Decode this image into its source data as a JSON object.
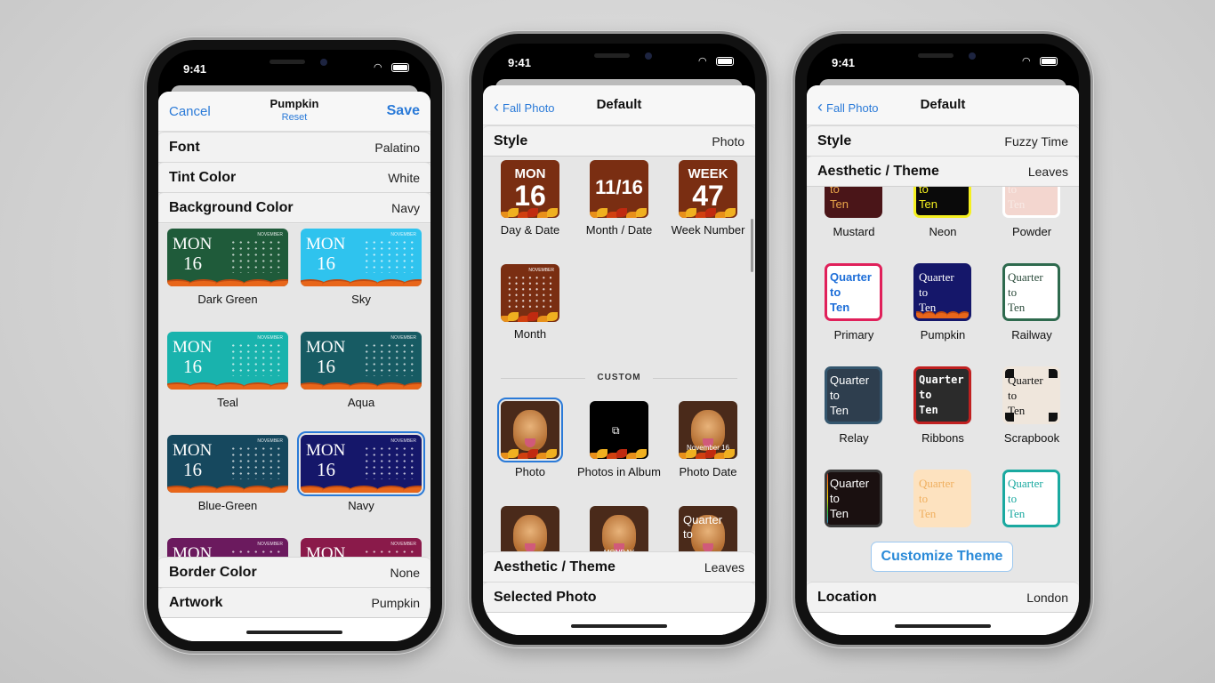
{
  "status_time": "9:41",
  "phones": [
    {
      "nav": {
        "left": "Cancel",
        "title": "Pumpkin",
        "subtitle": "Reset",
        "right": "Save"
      },
      "rows_top": [
        {
          "label": "Font",
          "value": "Palatino"
        },
        {
          "label": "Tint Color",
          "value": "White"
        },
        {
          "label": "Background Color",
          "value": "Navy"
        }
      ],
      "tile_text": {
        "day": "MON",
        "date": "16",
        "month": "NOVEMBER"
      },
      "tiles": [
        {
          "label": "Dark Green",
          "bg": "#1f5b3a"
        },
        {
          "label": "Sky",
          "bg": "#2fc3ee"
        },
        {
          "label": "Teal",
          "bg": "#19b3ad"
        },
        {
          "label": "Aqua",
          "bg": "#175b63"
        },
        {
          "label": "Blue-Green",
          "bg": "#16485e"
        },
        {
          "label": "Navy",
          "bg": "#15176a",
          "selected": true
        },
        {
          "label": "",
          "bg": "#6b1a5e"
        },
        {
          "label": "",
          "bg": "#8a1a4a"
        }
      ],
      "rows_bottom": [
        {
          "label": "Border Color",
          "value": "None"
        },
        {
          "label": "Artwork",
          "value": "Pumpkin"
        }
      ]
    },
    {
      "nav": {
        "left": "Fall Photo",
        "title": "Default"
      },
      "rows_top": [
        {
          "label": "Style",
          "value": "Photo"
        }
      ],
      "section_header": "CUSTOM",
      "tiles": [
        {
          "label": "Day & Date",
          "kind": "text",
          "line1": "MON",
          "line2": "16"
        },
        {
          "label": "Month / Date",
          "kind": "text",
          "line1": "",
          "line2": "11/16"
        },
        {
          "label": "Week Number",
          "kind": "text",
          "line1": "WEEK",
          "line2": "47"
        },
        {
          "label": "Month",
          "kind": "calendar",
          "line1": "NOVEMBER"
        }
      ],
      "custom_tiles": [
        {
          "label": "Photo",
          "kind": "photo",
          "selected": true
        },
        {
          "label": "Photos in Album",
          "kind": "album"
        },
        {
          "label": "Photo Date",
          "kind": "photo",
          "caption": "November 16"
        },
        {
          "label": "",
          "kind": "photo"
        },
        {
          "label": "",
          "kind": "photo",
          "caption": "MONDAY"
        },
        {
          "label": "",
          "kind": "photo",
          "overlay": "Quarter to"
        }
      ],
      "tile_bg": "#7a2e12",
      "rows_bottom": [
        {
          "label": "Aesthetic / Theme",
          "value": "Leaves"
        },
        {
          "label": "Selected Photo",
          "value": ""
        }
      ]
    },
    {
      "nav": {
        "left": "Fall Photo",
        "title": "Default"
      },
      "rows_top": [
        {
          "label": "Style",
          "value": "Fuzzy Time"
        },
        {
          "label": "Aesthetic / Theme",
          "value": "Leaves"
        }
      ],
      "sample_text": [
        "Quarter",
        "to",
        "Ten"
      ],
      "themes": [
        {
          "label": "Mustard",
          "bg": "#4a1518",
          "fg": "#e8a54a",
          "border": "#4a1518",
          "style": "sans"
        },
        {
          "label": "Neon",
          "bg": "#0a0a0a",
          "fg": "#f5f020",
          "border": "#f5f020",
          "style": "sans"
        },
        {
          "label": "Powder",
          "bg": "#f3d6cf",
          "fg": "#f8eae6",
          "border": "#ffffff",
          "style": "serif"
        },
        {
          "label": "Primary",
          "bg": "#ffffff",
          "fg": "#1d6ed8",
          "border": "#e0205a",
          "style": "sans-bold"
        },
        {
          "label": "Pumpkin",
          "bg": "#15176a",
          "fg": "#ffffff",
          "border": "#15176a",
          "style": "serif",
          "pumpkins": true
        },
        {
          "label": "Railway",
          "bg": "#ffffff",
          "fg": "#2a4a3a",
          "border": "#2e6a4e",
          "style": "serif"
        },
        {
          "label": "Relay",
          "bg": "#2e3e4e",
          "fg": "#ffffff",
          "border": "#34566e",
          "style": "sans"
        },
        {
          "label": "Ribbons",
          "bg": "#2b2b2b",
          "fg": "#ffffff",
          "border": "#c02020",
          "style": "mono"
        },
        {
          "label": "Scrapbook",
          "bg": "#efe6dc",
          "fg": "#111111",
          "border": "#efe6dc",
          "style": "serif",
          "corners": true
        },
        {
          "label": "",
          "bg": "#1a1010",
          "fg": "#ffffff",
          "border": "#3a3a3a",
          "style": "sans",
          "rainbow": true
        },
        {
          "label": "",
          "bg": "#fde2bf",
          "fg": "#f0b060",
          "border": "#fde2bf",
          "style": "serif"
        },
        {
          "label": "",
          "bg": "#ffffff",
          "fg": "#1aa9a0",
          "border": "#1aa9a0",
          "style": "serif"
        }
      ],
      "customize_button": "Customize Theme",
      "rows_bottom": [
        {
          "label": "Location",
          "value": "London"
        }
      ]
    }
  ],
  "colors": {
    "accent": "#2a7ad8",
    "selection": "#2a7ad8"
  }
}
